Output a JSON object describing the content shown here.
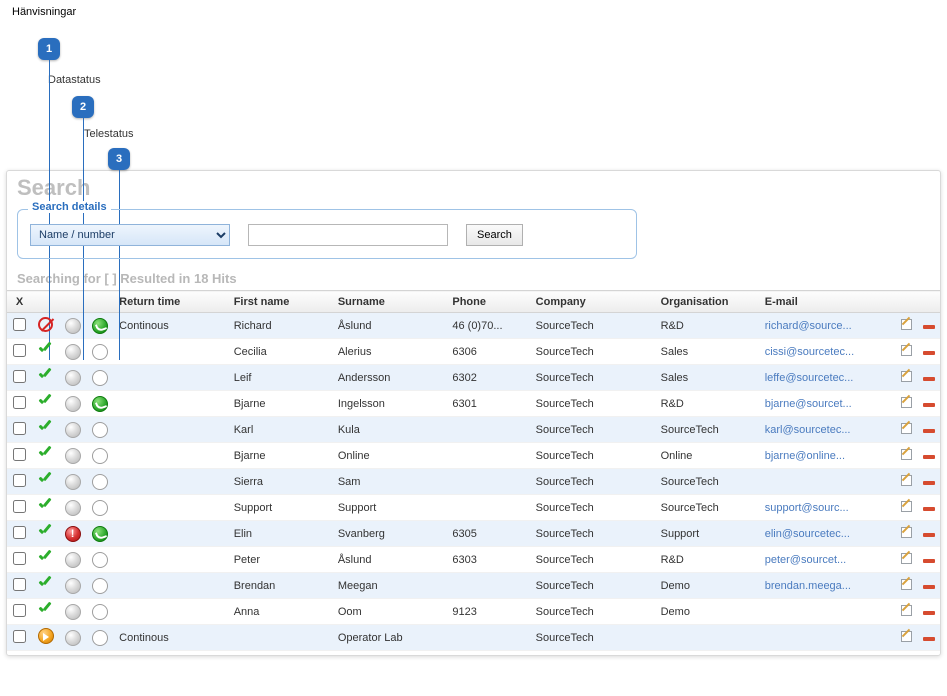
{
  "annotations": {
    "heading": "Hänvisningar",
    "items": [
      {
        "num": "1",
        "label": ""
      },
      {
        "num": "2",
        "label": "Datastatus"
      },
      {
        "num": "3",
        "label": "Telestatus"
      }
    ]
  },
  "panel": {
    "title": "Search",
    "fieldset_legend": "Search details",
    "dropdown_value": "Name / number",
    "search_value": "",
    "search_button": "Search",
    "results_heading": "Searching for [ ] Resulted in 18 Hits"
  },
  "columns": {
    "select": "X",
    "col1": "",
    "col2": "",
    "col3": "",
    "return_time": "Return time",
    "first_name": "First name",
    "surname": "Surname",
    "phone": "Phone",
    "company": "Company",
    "organisation": "Organisation",
    "email": "E-mail"
  },
  "rows": [
    {
      "status1": "forbid",
      "status2": "grey",
      "status3": "phone",
      "return_time": "Continous",
      "first_name": "Richard",
      "surname": "Åslund",
      "phone": "46 (0)70...",
      "company": "SourceTech",
      "organisation": "R&D",
      "email": "richard@source..."
    },
    {
      "status1": "check",
      "status2": "grey",
      "status3": "hollow",
      "return_time": "",
      "first_name": "Cecilia",
      "surname": "Alerius",
      "phone": "6306",
      "company": "SourceTech",
      "organisation": "Sales",
      "email": "cissi@sourcetec..."
    },
    {
      "status1": "check",
      "status2": "grey",
      "status3": "hollow",
      "return_time": "",
      "first_name": "Leif",
      "surname": "Andersson",
      "phone": "6302",
      "company": "SourceTech",
      "organisation": "Sales",
      "email": "leffe@sourcetec..."
    },
    {
      "status1": "check",
      "status2": "grey",
      "status3": "phone",
      "return_time": "",
      "first_name": "Bjarne",
      "surname": "Ingelsson",
      "phone": "6301",
      "company": "SourceTech",
      "organisation": "R&D",
      "email": "bjarne@sourcet..."
    },
    {
      "status1": "check",
      "status2": "grey",
      "status3": "hollow",
      "return_time": "",
      "first_name": "Karl",
      "surname": "Kula",
      "phone": "",
      "company": "SourceTech",
      "organisation": "SourceTech",
      "email": "karl@sourcetec..."
    },
    {
      "status1": "check",
      "status2": "grey",
      "status3": "hollow",
      "return_time": "",
      "first_name": "Bjarne",
      "surname": "Online",
      "phone": "",
      "company": "SourceTech",
      "organisation": "Online",
      "email": "bjarne@online..."
    },
    {
      "status1": "check",
      "status2": "grey",
      "status3": "hollow",
      "return_time": "",
      "first_name": "Sierra",
      "surname": "Sam",
      "phone": "",
      "company": "SourceTech",
      "organisation": "SourceTech",
      "email": ""
    },
    {
      "status1": "check",
      "status2": "grey",
      "status3": "hollow",
      "return_time": "",
      "first_name": "Support",
      "surname": "Support",
      "phone": "",
      "company": "SourceTech",
      "organisation": "SourceTech",
      "email": "support@sourc..."
    },
    {
      "status1": "check",
      "status2": "alert",
      "status3": "phone",
      "return_time": "",
      "first_name": "Elin",
      "surname": "Svanberg",
      "phone": "6305",
      "company": "SourceTech",
      "organisation": "Support",
      "email": "elin@sourcetec..."
    },
    {
      "status1": "check",
      "status2": "grey",
      "status3": "hollow",
      "return_time": "",
      "first_name": "Peter",
      "surname": "Åslund",
      "phone": "6303",
      "company": "SourceTech",
      "organisation": "R&D",
      "email": "peter@sourcet..."
    },
    {
      "status1": "check",
      "status2": "grey",
      "status3": "hollow",
      "return_time": "",
      "first_name": "Brendan",
      "surname": "Meegan",
      "phone": "",
      "company": "SourceTech",
      "organisation": "Demo",
      "email": "brendan.meega..."
    },
    {
      "status1": "check",
      "status2": "grey",
      "status3": "hollow",
      "return_time": "",
      "first_name": "Anna",
      "surname": "Oom",
      "phone": "9123",
      "company": "SourceTech",
      "organisation": "Demo",
      "email": ""
    },
    {
      "status1": "away",
      "status2": "grey",
      "status3": "hollow",
      "return_time": "Continous",
      "first_name": "",
      "surname": "Operator Lab",
      "phone": "",
      "company": "SourceTech",
      "organisation": "",
      "email": ""
    }
  ]
}
